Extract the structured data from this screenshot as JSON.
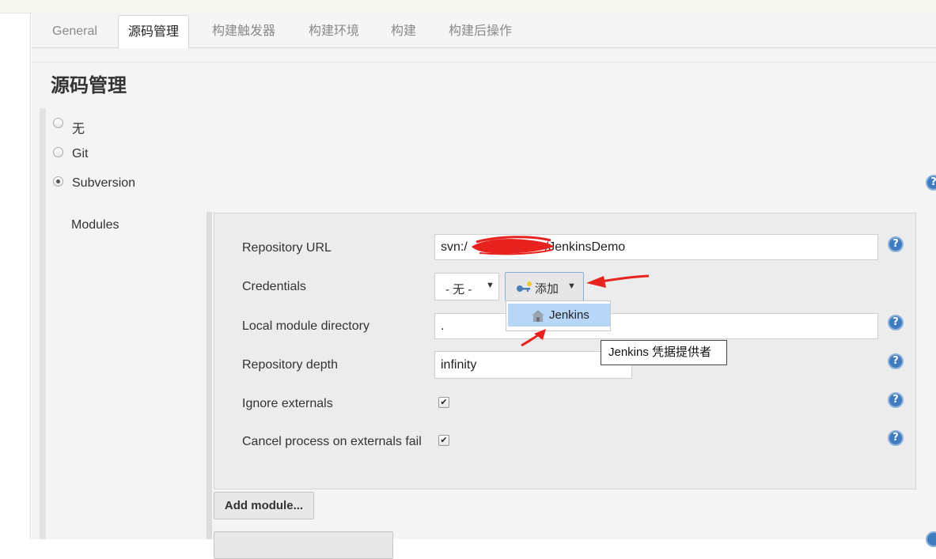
{
  "tabs": [
    {
      "label": "General"
    },
    {
      "label": "源码管理"
    },
    {
      "label": "构建触发器"
    },
    {
      "label": "构建环境"
    },
    {
      "label": "构建"
    },
    {
      "label": "构建后操作"
    }
  ],
  "section_title": "源码管理",
  "scm_options": [
    {
      "label": "无",
      "selected": false
    },
    {
      "label": "Git",
      "selected": false
    },
    {
      "label": "Subversion",
      "selected": true
    }
  ],
  "modules_label": "Modules",
  "fields": {
    "repository_url": {
      "label": "Repository URL",
      "value_prefix": "svn:/",
      "value_suffix": "/JenkinsDemo"
    },
    "credentials": {
      "label": "Credentials",
      "selected": "- 无 -",
      "add_button": "添加"
    },
    "local_module_directory": {
      "label": "Local module directory",
      "value": "."
    },
    "repository_depth": {
      "label": "Repository depth",
      "value": "infinity"
    },
    "ignore_externals": {
      "label": "Ignore externals",
      "checked": true
    },
    "cancel_on_externals_fail": {
      "label": "Cancel process on externals fail",
      "checked": true
    }
  },
  "add_menu": {
    "items": [
      {
        "label": "Jenkins"
      }
    ]
  },
  "tooltip": "Jenkins 凭据提供者",
  "add_module_button": "Add module...",
  "help_glyph": "?",
  "check_glyph": "✔",
  "colors": {
    "annotation_red": "#e8231f",
    "menu_highlight": "#b8d6f8",
    "help_blue": "#3f7cbf"
  }
}
